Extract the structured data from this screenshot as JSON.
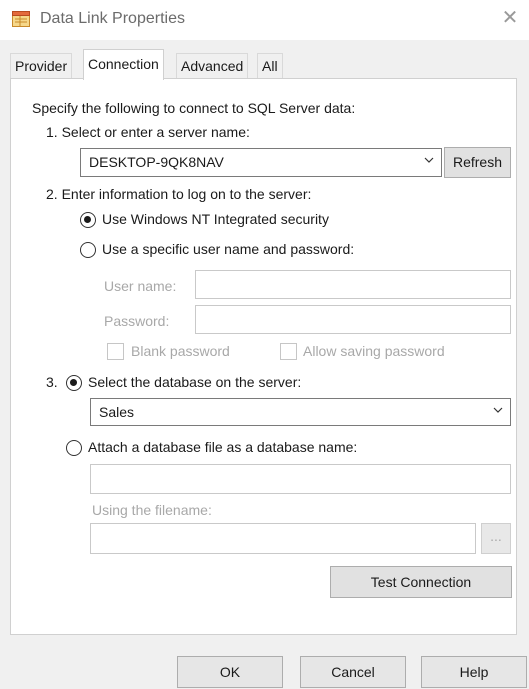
{
  "window": {
    "title": "Data Link Properties",
    "close_icon": "close-icon",
    "app_icon": "data-link-icon"
  },
  "tabs": [
    {
      "label": "Provider",
      "active": false
    },
    {
      "label": "Connection",
      "active": true
    },
    {
      "label": "Advanced",
      "active": false
    },
    {
      "label": "All",
      "active": false
    }
  ],
  "connection": {
    "intro": "Specify the following to connect to SQL Server data:",
    "step1": "1. Select or enter a server name:",
    "server_name": "DESKTOP-9QK8NAV",
    "refresh_label": "Refresh",
    "step2": "2. Enter information to log on to the server:",
    "logon_options": [
      {
        "label": "Use Windows NT Integrated security",
        "selected": true
      },
      {
        "label": "Use a specific user name and password:",
        "selected": false
      }
    ],
    "username_label": "User name:",
    "username_value": "",
    "password_label": "Password:",
    "password_value": "",
    "blank_password_label": "Blank password",
    "blank_password_checked": false,
    "allow_saving_label": "Allow saving password",
    "allow_saving_checked": false,
    "step3_number": "3.",
    "select_db_label": "Select the database on the server:",
    "select_db_selected": true,
    "database_name": "Sales",
    "attach_db_label": "Attach a database file as a database name:",
    "attach_db_selected": false,
    "attach_db_value": "",
    "filename_label": "Using the filename:",
    "filename_value": "",
    "browse_label": "...",
    "test_connection_label": "Test Connection"
  },
  "footer": {
    "ok_label": "OK",
    "cancel_label": "Cancel",
    "help_label": "Help"
  }
}
